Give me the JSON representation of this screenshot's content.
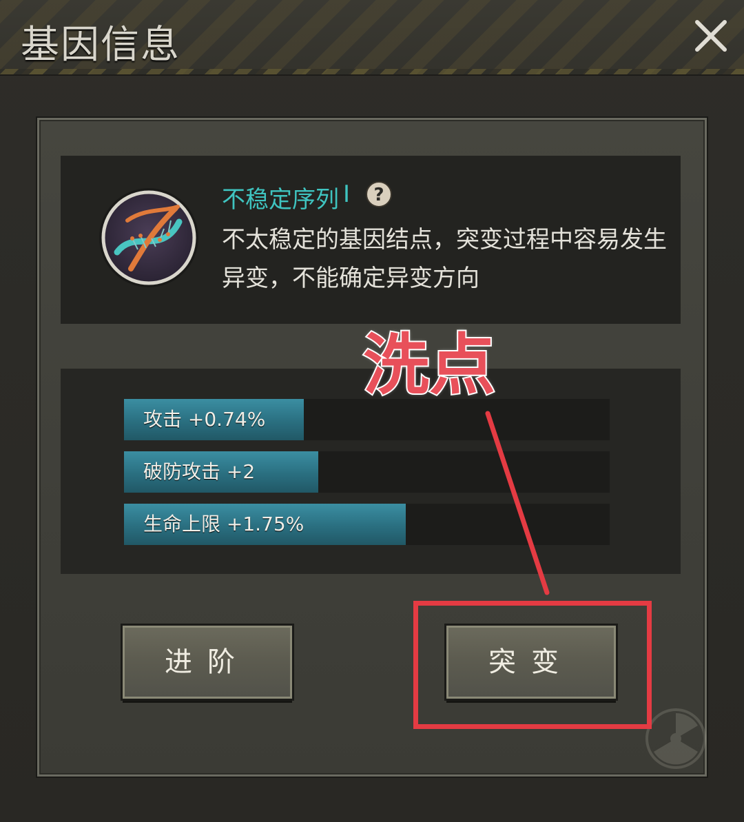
{
  "window": {
    "title": "基因信息",
    "close_icon": "close-icon"
  },
  "gene": {
    "icon": "dna-icon",
    "name": "不稳定序列",
    "level": "Ⅰ",
    "help_icon": "question-icon",
    "description": "不太稳定的基因结点，突变过程中容易发生异变，不能确定异变方向"
  },
  "stats": [
    {
      "label": "攻击 +0.74%",
      "fill_percent": 37
    },
    {
      "label": "破防攻击 +2",
      "fill_percent": 40
    },
    {
      "label": "生命上限 +1.75%",
      "fill_percent": 58
    }
  ],
  "buttons": {
    "advance_label": "进阶",
    "mutate_label": "突变"
  },
  "annotation": {
    "text": "洗点",
    "color": "#e43b43"
  }
}
